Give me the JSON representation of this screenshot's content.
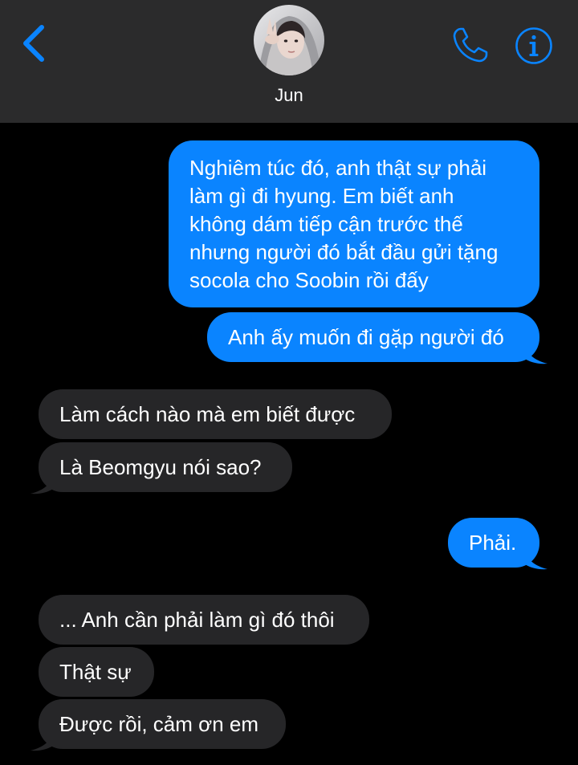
{
  "header": {
    "contact_name": "Jun",
    "back_icon": "chevron-left-icon",
    "call_icon": "phone-icon",
    "info_icon": "info-icon",
    "accent_color": "#0a84ff",
    "background": "#2b2b2c"
  },
  "thread": {
    "sent_color": "#0a84ff",
    "received_color": "#262628",
    "messages": [
      {
        "from": "me",
        "text": "Nghiêm túc đó, anh thật sự phải\nlàm gì đi hyung. Em biết anh\nkhông dám tiếp cận trước thế\nnhưng người đó bắt đầu gửi tặng\nsocola cho Soobin rồi đấy"
      },
      {
        "from": "me",
        "text": "Anh ấy muốn đi gặp người đó"
      },
      {
        "from": "them",
        "text": "Làm cách nào mà em biết được"
      },
      {
        "from": "them",
        "text": "Là Beomgyu nói sao?"
      },
      {
        "from": "me",
        "text": "Phải."
      },
      {
        "from": "them",
        "text": "... Anh cần phải làm gì đó thôi"
      },
      {
        "from": "them",
        "text": "Thật sự"
      },
      {
        "from": "them",
        "text": "Được rồi, cảm ơn em"
      }
    ]
  }
}
